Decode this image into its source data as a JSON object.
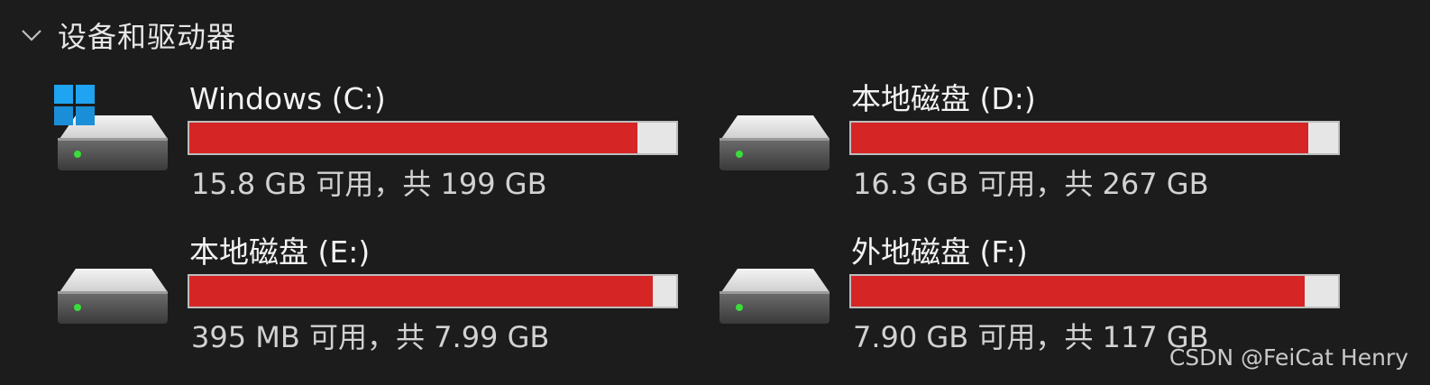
{
  "group": {
    "title": "设备和驱动器",
    "expanded_icon": "chevron-down-icon"
  },
  "drives": [
    {
      "name": "Windows (C:)",
      "free_text": "15.8 GB 可用，共 199 GB",
      "used_fraction": 0.921,
      "icon": "hard-drive-icon",
      "os_badge": "windows-logo-icon"
    },
    {
      "name": "本地磁盘 (D:)",
      "free_text": "16.3 GB 可用，共 267 GB",
      "used_fraction": 0.939,
      "icon": "hard-drive-icon"
    },
    {
      "name": "本地磁盘 (E:)",
      "free_text": "395 MB 可用，共 7.99 GB",
      "used_fraction": 0.952,
      "icon": "hard-drive-icon"
    },
    {
      "name": "外地磁盘 (F:)",
      "free_text": "7.90 GB 可用，共 117 GB",
      "used_fraction": 0.932,
      "icon": "hard-drive-icon"
    }
  ],
  "colors": {
    "background": "#1c1c1c",
    "bar_used": "#d52525",
    "bar_free": "#e6e6e6"
  },
  "watermark": "CSDN @FeiCat Henry"
}
